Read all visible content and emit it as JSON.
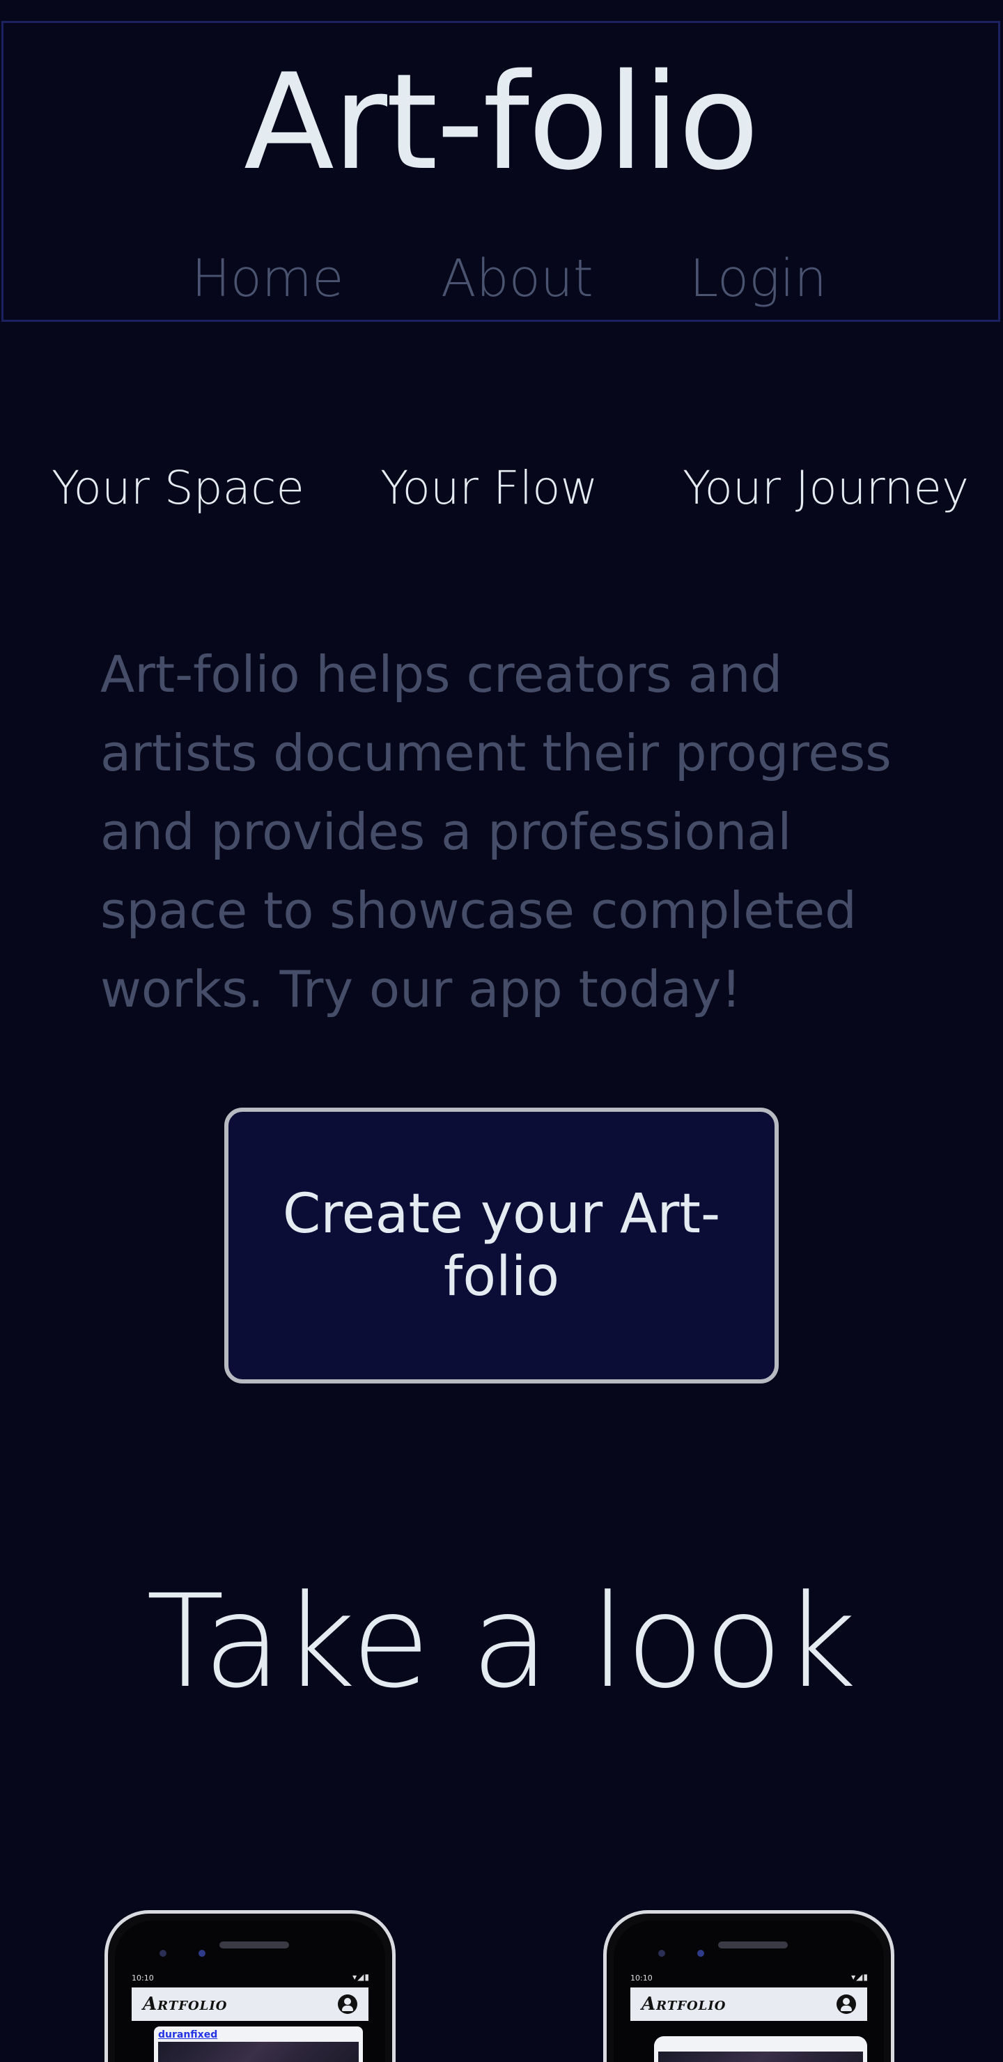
{
  "header": {
    "title": "Art-folio",
    "nav": [
      {
        "label": "Home"
      },
      {
        "label": "About"
      },
      {
        "label": "Login"
      }
    ]
  },
  "taglines": [
    "Your Space",
    "Your Flow",
    "Your Journey"
  ],
  "description": "Art-folio helps creators and artists document their progress and provides a professional space to showcase completed works. Try our app today!",
  "cta": {
    "label": "Create your Art-folio"
  },
  "preview": {
    "title": "Take a look",
    "phones": [
      {
        "status_time": "10:10",
        "status_icons": "▾◢▮",
        "app_logo": "Artfolio",
        "post_user": "duranfixed"
      },
      {
        "status_time": "10:10",
        "status_icons": "▾◢▮",
        "app_logo": "Artfolio",
        "post_user": ""
      }
    ]
  },
  "colors": {
    "background": "#06071a",
    "header_border": "#1c2260",
    "heading_text": "#e4ecf2",
    "muted_text": "#454d68",
    "cta_fill": "#0c0d36",
    "cta_border": "#b8bac2"
  }
}
